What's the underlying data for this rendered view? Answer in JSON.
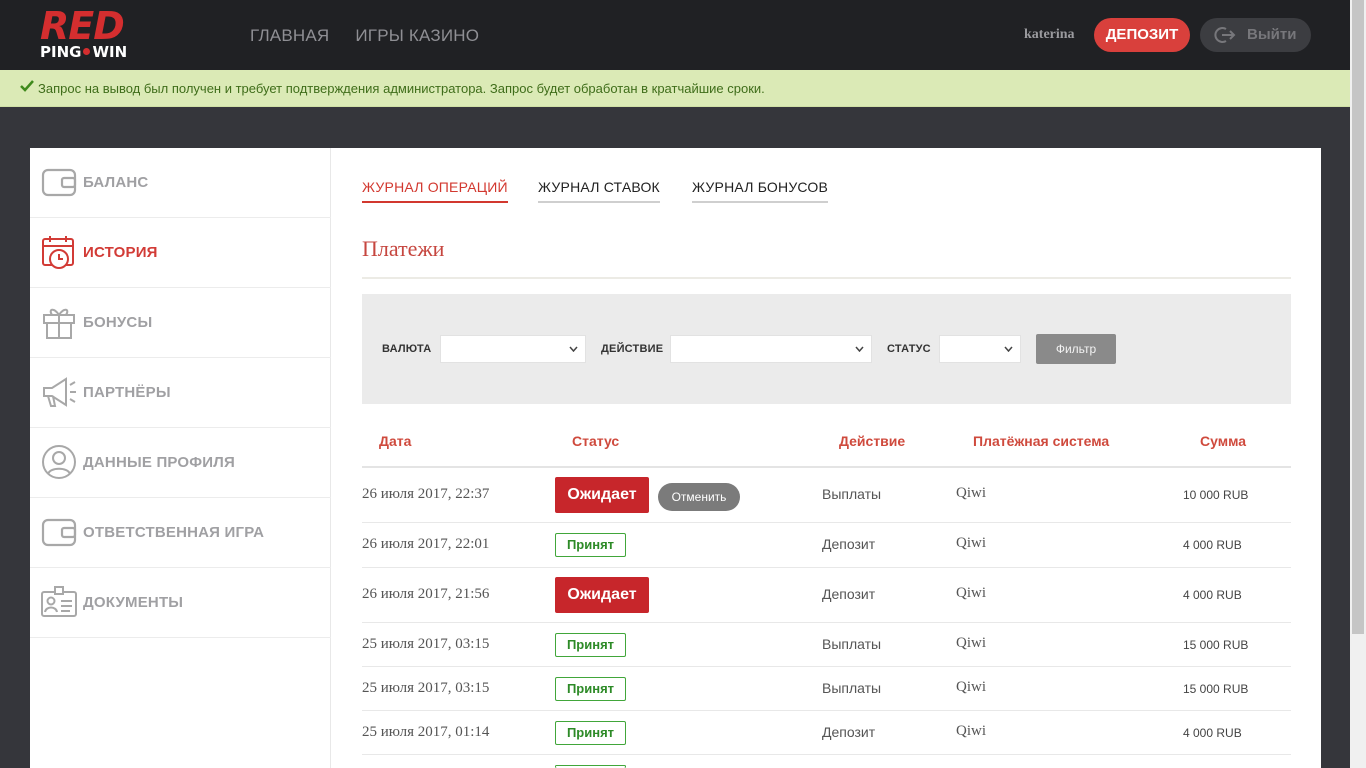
{
  "header": {
    "logo_top": "RED",
    "logo_left": "PING",
    "logo_right": "WIN",
    "nav": [
      "ГЛАВНАЯ",
      "ИГРЫ КАЗИНО"
    ],
    "username": "katerina",
    "deposit_label": "ДЕПОЗИТ",
    "logout_label": "Выйти"
  },
  "notice": {
    "text": "Запрос на вывод был получен и требует подтверждения администратора. Запрос будет обработан в кратчайшие сроки."
  },
  "sidebar": {
    "items": [
      {
        "label": "БАЛАНС",
        "icon": "wallet-icon"
      },
      {
        "label": "ИСТОРИЯ",
        "icon": "calendar-clock-icon",
        "active": true
      },
      {
        "label": "БОНУСЫ",
        "icon": "gift-icon"
      },
      {
        "label": "ПАРТНЁРЫ",
        "icon": "megaphone-icon"
      },
      {
        "label": "ДАННЫЕ ПРОФИЛЯ",
        "icon": "user-circle-icon"
      },
      {
        "label": "ОТВЕТСТВЕННАЯ ИГРА",
        "icon": "wallet-icon"
      },
      {
        "label": "ДОКУМЕНТЫ",
        "icon": "id-card-icon"
      }
    ]
  },
  "tabs": [
    "ЖУРНАЛ ОПЕРАЦИЙ",
    "ЖУРНАЛ СТАВОК",
    "ЖУРНАЛ БОНУСОВ"
  ],
  "section_title": "Платежи",
  "filter": {
    "currency_label": "ВАЛЮТА",
    "action_label": "ДЕЙСТВИЕ",
    "status_label": "СТАТУС",
    "button_label": "Фильтр"
  },
  "table": {
    "headers": [
      "Дата",
      "Статус",
      "Действие",
      "Платёжная система",
      "Сумма"
    ],
    "cancel_label": "Отменить",
    "rows": [
      {
        "date": "26 июля 2017, 22:37",
        "status": "Ожидает",
        "action": "Выплаты",
        "system": "Qiwi",
        "amount": "10 000 RUB"
      },
      {
        "date": "26 июля 2017, 22:01",
        "status": "Принят",
        "action": "Депозит",
        "system": "Qiwi",
        "amount": "4 000 RUB"
      },
      {
        "date": "26 июля 2017, 21:56",
        "status": "Ожидает",
        "action": "Депозит",
        "system": "Qiwi",
        "amount": "4 000 RUB"
      },
      {
        "date": "25 июля 2017, 03:15",
        "status": "Принят",
        "action": "Выплаты",
        "system": "Qiwi",
        "amount": "15 000 RUB"
      },
      {
        "date": "25 июля 2017, 03:15",
        "status": "Принят",
        "action": "Выплаты",
        "system": "Qiwi",
        "amount": "15 000 RUB"
      },
      {
        "date": "25 июля 2017, 01:14",
        "status": "Принят",
        "action": "Депозит",
        "system": "Qiwi",
        "amount": "4 000 RUB"
      }
    ]
  },
  "colors": {
    "accent": "#d9403c",
    "header_bg": "#202124",
    "notice_bg": "#dbeab6",
    "pending": "#c7262b",
    "accepted": "#41a63a"
  }
}
